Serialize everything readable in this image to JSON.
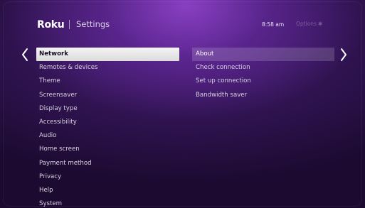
{
  "header": {
    "brand": "Roku",
    "title": "Settings",
    "time": "8:58 am",
    "options_label": "Options",
    "options_glyph": "✱"
  },
  "nav": {
    "left_arrow_icon": "chevron-left-icon",
    "right_arrow_icon": "chevron-right-icon"
  },
  "menu": {
    "items": [
      {
        "label": "Network"
      },
      {
        "label": "Remotes & devices"
      },
      {
        "label": "Theme"
      },
      {
        "label": "Screensaver"
      },
      {
        "label": "Display type"
      },
      {
        "label": "Accessibility"
      },
      {
        "label": "Audio"
      },
      {
        "label": "Home screen"
      },
      {
        "label": "Payment method"
      },
      {
        "label": "Privacy"
      },
      {
        "label": "Help"
      },
      {
        "label": "System"
      }
    ],
    "selected_index": 0
  },
  "submenu": {
    "items": [
      {
        "label": "About"
      },
      {
        "label": "Check connection"
      },
      {
        "label": "Set up connection"
      },
      {
        "label": "Bandwidth saver"
      }
    ],
    "highlighted_index": 0
  },
  "colors": {
    "background_top": "#9646d2",
    "background_base": "#2f1350",
    "selected_bg": "#eeeeee",
    "selected_text": "#1a1024",
    "menu_text": "#d8d2e0"
  }
}
